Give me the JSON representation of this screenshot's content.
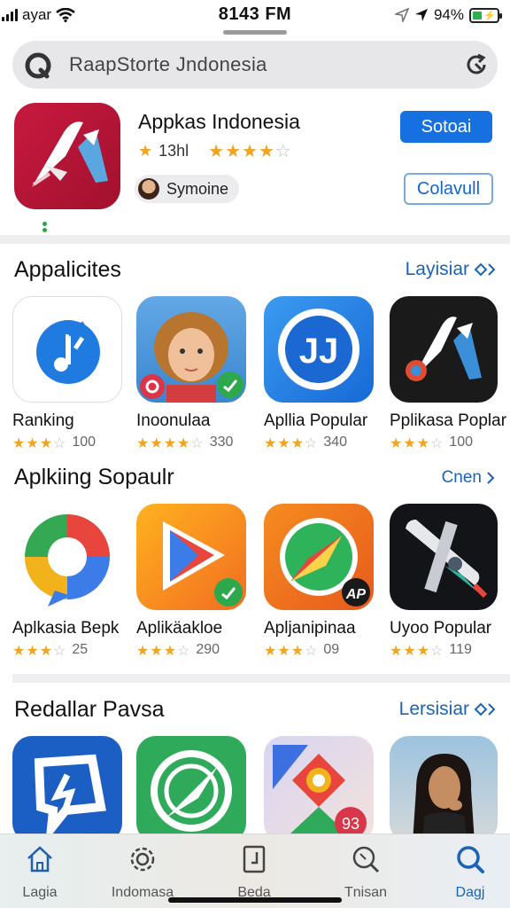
{
  "status_bar": {
    "carrier": "ayar",
    "time": "8143 FM",
    "battery": "94%"
  },
  "search": {
    "placeholder": "RaapStorte Jndonesia"
  },
  "featured": {
    "title": "Appkas Indonesia",
    "rating_label": "13hl",
    "rating_stars": 4,
    "user_name": "Symoine",
    "primary_button": "Sotoai",
    "secondary_button": "Colavull",
    "accent_color": "#1670e0",
    "icon_color": "#c8193f"
  },
  "sections": [
    {
      "title": "Appalicites",
      "link": "Layisiar",
      "apps": [
        {
          "name": "Ranking",
          "stars": 3,
          "count": "100",
          "icon": "music-note-icon"
        },
        {
          "name": "Inoonulaa",
          "stars": 4,
          "count": "330",
          "icon": "child-photo-icon"
        },
        {
          "name": "Apllia Popular",
          "stars": 3,
          "count": "340",
          "icon": "jj-logo-icon"
        },
        {
          "name": "Pplikasa Poplar",
          "stars": 3,
          "count": "100",
          "icon": "rocket-icon"
        }
      ]
    },
    {
      "title": "Aplkiing Sopaulr",
      "link": "Cnen",
      "apps": [
        {
          "name": "Aplkasia Bepk",
          "stars": 3,
          "count": "25",
          "icon": "chat-bubble-icon"
        },
        {
          "name": "Aplikäakloe",
          "stars": 3,
          "count": "290",
          "icon": "play-arrow-icon"
        },
        {
          "name": "Apljanipinaa",
          "stars": 3,
          "count": "09",
          "icon": "compass-icon"
        },
        {
          "name": "Uyoo Popular",
          "stars": 3,
          "count": "119",
          "icon": "spaceship-icon"
        }
      ]
    },
    {
      "title": "Redallar Pavsa",
      "link": "Lersisiar",
      "apps": [
        {
          "name": "",
          "icon": "message-bolt-icon"
        },
        {
          "name": "",
          "icon": "compass-green-icon"
        },
        {
          "name": "",
          "icon": "puzzle-icon",
          "badge": "93"
        },
        {
          "name": "",
          "icon": "woman-photo-icon"
        }
      ]
    }
  ],
  "tabs": [
    {
      "label": "Lagia",
      "icon": "home-icon"
    },
    {
      "label": "Indomasa",
      "icon": "gear-icon"
    },
    {
      "label": "Beda",
      "icon": "document-icon"
    },
    {
      "label": "Tnisan",
      "icon": "search-icon"
    },
    {
      "label": "Dagj",
      "icon": "search-icon",
      "active": true
    }
  ]
}
